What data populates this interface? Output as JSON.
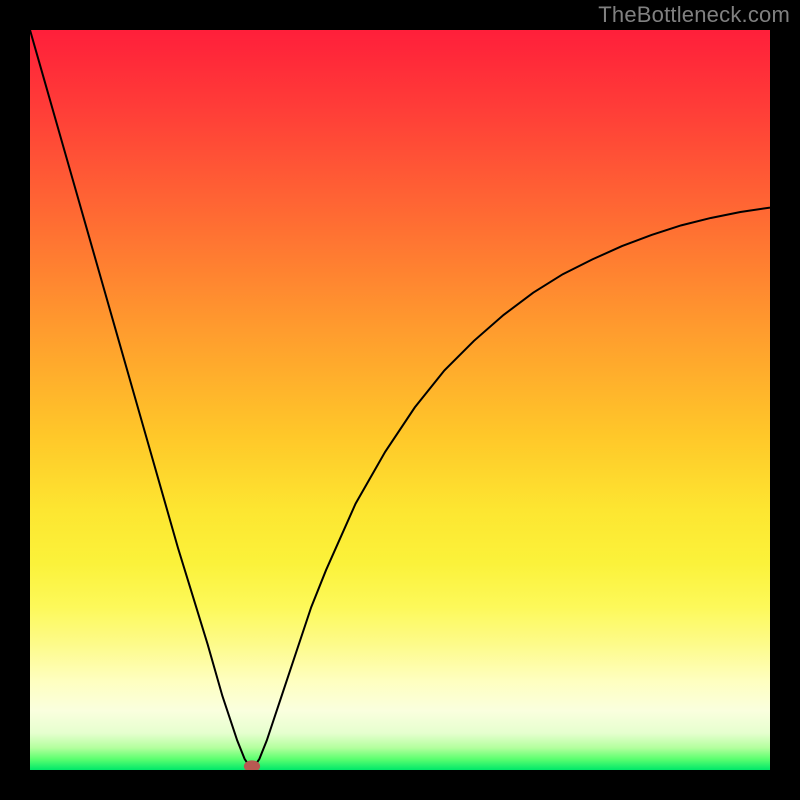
{
  "watermark": "TheBottleneck.com",
  "chart_data": {
    "type": "line",
    "title": "",
    "xlabel": "",
    "ylabel": "",
    "xlim": [
      0,
      100
    ],
    "ylim": [
      0,
      100
    ],
    "minimum_x": 30,
    "minimum_marker": {
      "x": 30,
      "y": 0.5,
      "color": "#b85a52"
    },
    "gradient": {
      "top_color": "#ff1f3a",
      "mid_color": "#fde631",
      "bottom_color": "#00e86a"
    },
    "series": [
      {
        "name": "bottleneck-curve",
        "x": [
          0,
          2,
          4,
          6,
          8,
          10,
          12,
          14,
          16,
          18,
          20,
          22,
          24,
          26,
          27,
          28,
          29,
          30,
          31,
          32,
          33,
          34,
          36,
          38,
          40,
          44,
          48,
          52,
          56,
          60,
          64,
          68,
          72,
          76,
          80,
          84,
          88,
          92,
          96,
          100
        ],
        "y": [
          100,
          93,
          86,
          79,
          72,
          65,
          58,
          51,
          44,
          37,
          30,
          23.5,
          17,
          10,
          7,
          4,
          1.5,
          0,
          1.5,
          4,
          7,
          10,
          16,
          22,
          27,
          36,
          43,
          49,
          54,
          58,
          61.5,
          64.5,
          67,
          69,
          70.8,
          72.3,
          73.6,
          74.6,
          75.4,
          76
        ]
      }
    ]
  }
}
